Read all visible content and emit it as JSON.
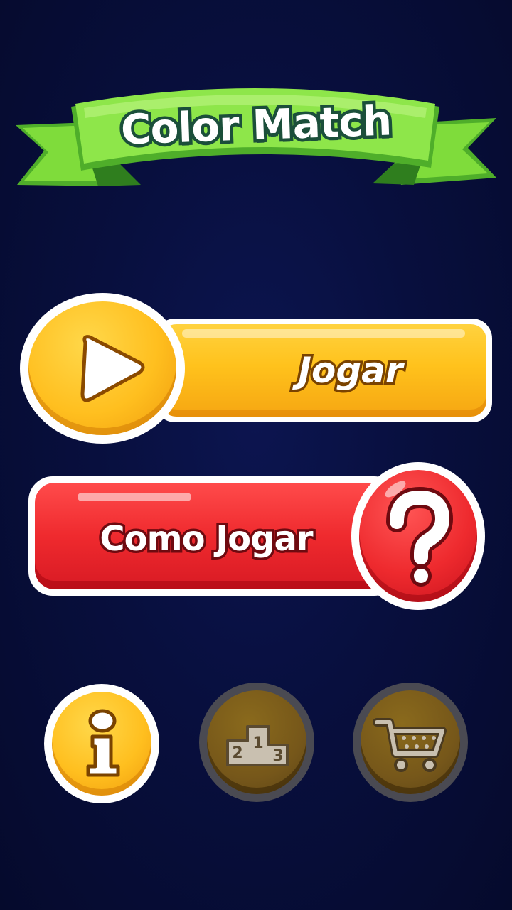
{
  "title": "Color Match",
  "play_button": {
    "label": "Jogar",
    "icon": "play-icon"
  },
  "how_to_play_button": {
    "label": "Como Jogar",
    "icon": "question-icon"
  },
  "bottom_buttons": [
    {
      "icon": "info-icon",
      "state": "enabled"
    },
    {
      "icon": "podium-icon",
      "state": "disabled",
      "podium_numbers": [
        "2",
        "1",
        "3"
      ]
    },
    {
      "icon": "cart-icon",
      "state": "disabled"
    }
  ],
  "colors": {
    "background": "#080f3e",
    "banner_green": "#7fdc3b",
    "play_yellow": "#ffc21c",
    "how_red": "#ef2a2e",
    "text_outline_green": "#1b4f3a"
  }
}
